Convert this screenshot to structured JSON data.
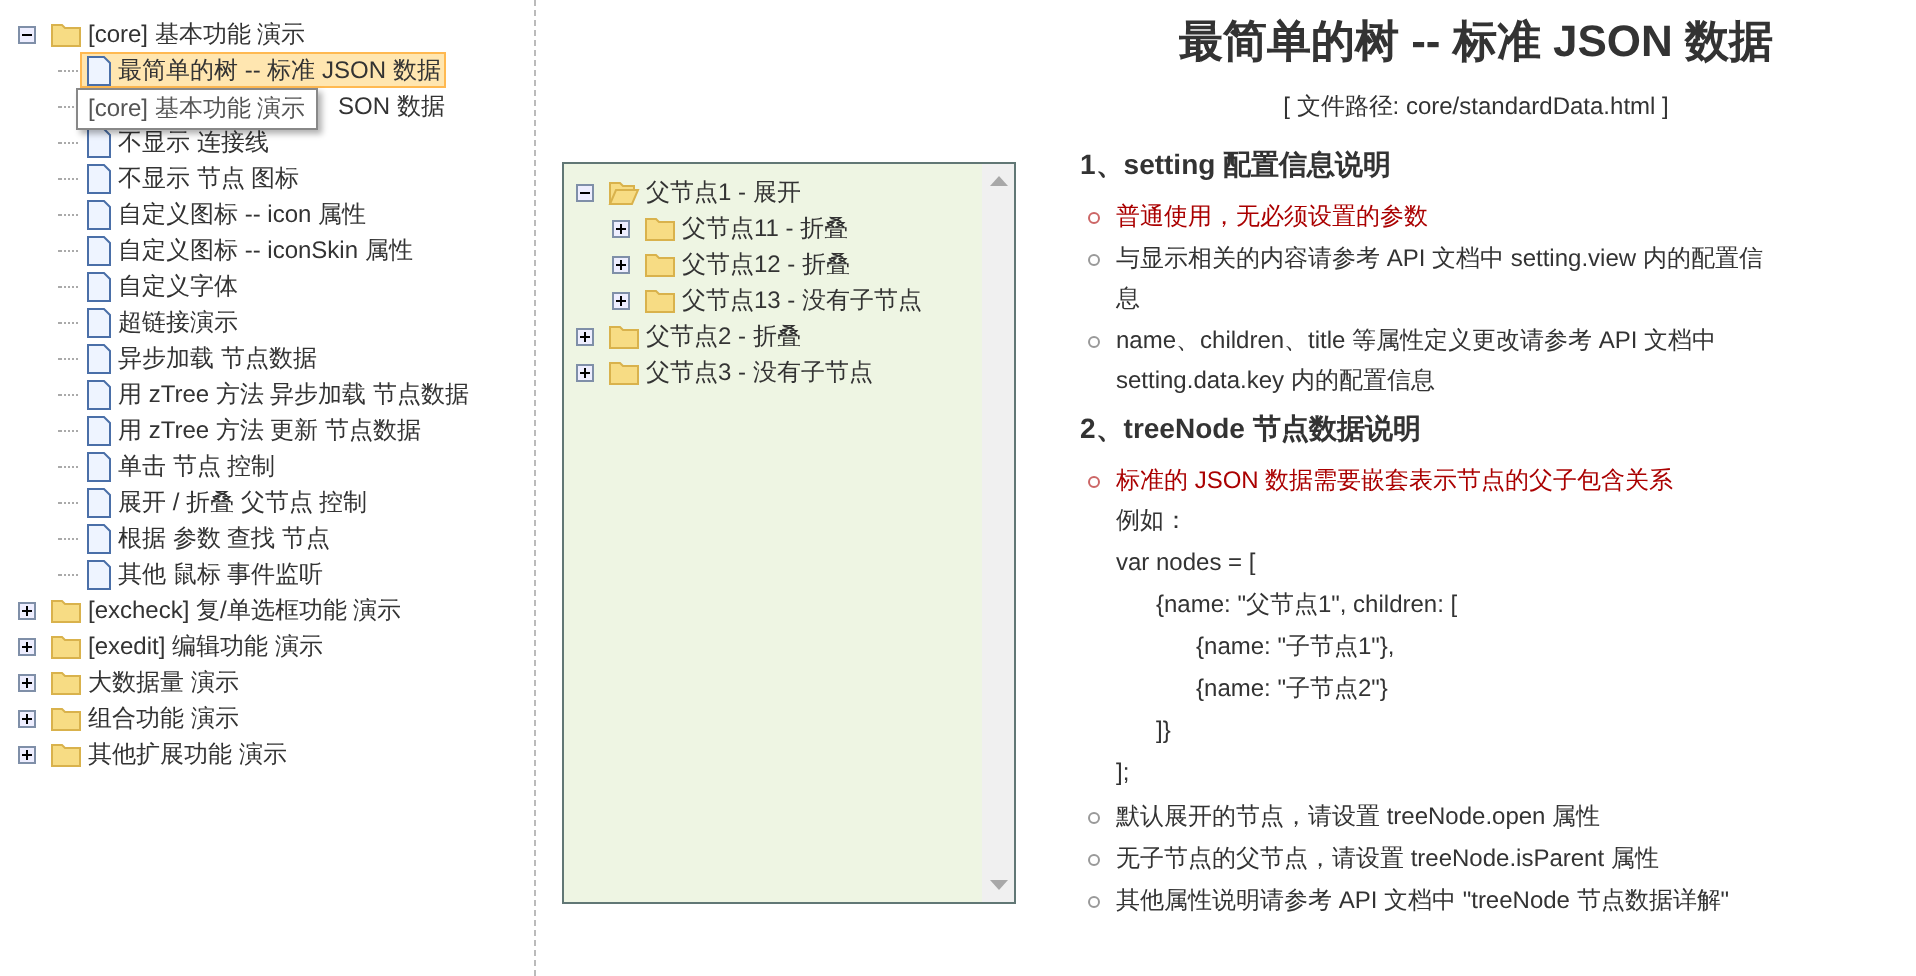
{
  "nav": {
    "items": [
      {
        "label": "[core] 基本功能 演示",
        "kind": "folder",
        "expanded": true,
        "selected": false,
        "children": [
          {
            "label": "最简单的树 -- 标准 JSON 数据",
            "kind": "page",
            "selected": true
          },
          {
            "label": "SON 数据",
            "kind": "page",
            "selected": false,
            "covered": true
          },
          {
            "label": "不显示 连接线",
            "kind": "page",
            "selected": false
          },
          {
            "label": "不显示 节点 图标",
            "kind": "page",
            "selected": false
          },
          {
            "label": "自定义图标 -- icon 属性",
            "kind": "page",
            "selected": false
          },
          {
            "label": "自定义图标 -- iconSkin 属性",
            "kind": "page",
            "selected": false
          },
          {
            "label": "自定义字体",
            "kind": "page",
            "selected": false
          },
          {
            "label": "超链接演示",
            "kind": "page",
            "selected": false
          },
          {
            "label": "异步加载 节点数据",
            "kind": "page",
            "selected": false
          },
          {
            "label": "用 zTree 方法 异步加载 节点数据",
            "kind": "page",
            "selected": false
          },
          {
            "label": "用 zTree 方法 更新 节点数据",
            "kind": "page",
            "selected": false
          },
          {
            "label": "单击 节点 控制",
            "kind": "page",
            "selected": false
          },
          {
            "label": "展开 / 折叠 父节点 控制",
            "kind": "page",
            "selected": false
          },
          {
            "label": "根据 参数 查找 节点",
            "kind": "page",
            "selected": false
          },
          {
            "label": "其他 鼠标 事件监听",
            "kind": "page",
            "selected": false
          }
        ]
      },
      {
        "label": "[excheck] 复/单选框功能 演示",
        "kind": "folder",
        "expanded": false,
        "selected": false
      },
      {
        "label": "[exedit] 编辑功能 演示",
        "kind": "folder",
        "expanded": false,
        "selected": false
      },
      {
        "label": "大数据量 演示",
        "kind": "folder",
        "expanded": false,
        "selected": false
      },
      {
        "label": "组合功能 演示",
        "kind": "folder",
        "expanded": false,
        "selected": false
      },
      {
        "label": "其他扩展功能 演示",
        "kind": "folder",
        "expanded": false,
        "selected": false
      }
    ],
    "tooltip": "[core] 基本功能 演示"
  },
  "demo_tree": {
    "items": [
      {
        "label": "父节点1 - 展开",
        "expanded": true,
        "children": [
          {
            "label": "父节点11 - 折叠",
            "expanded": false
          },
          {
            "label": "父节点12 - 折叠",
            "expanded": false
          },
          {
            "label": "父节点13 - 没有子节点",
            "expanded": false
          }
        ]
      },
      {
        "label": "父节点2 - 折叠",
        "expanded": false
      },
      {
        "label": "父节点3 - 没有子节点",
        "expanded": false
      }
    ]
  },
  "page": {
    "title": "最简单的树 -- 标准 JSON 数据",
    "path": "[ 文件路径: core/standardData.html ]",
    "sections": [
      {
        "heading": "1、setting 配置信息说明",
        "items": [
          {
            "text": "普通使用，无必须设置的参数",
            "kind": "note"
          },
          {
            "text": "与显示相关的内容请参考 API 文档中 setting.view 内的配置信息",
            "kind": "plain"
          },
          {
            "text": "name、children、title 等属性定义更改请参考 API 文档中 setting.data.key 内的配置信息",
            "kind": "plain"
          }
        ]
      },
      {
        "heading": "2、treeNode 节点数据说明",
        "items": [
          {
            "text": "标准的 JSON 数据需要嵌套表示节点的父子包含关系",
            "kind": "note",
            "example": [
              "例如：",
              "var nodes = [",
              "      {name: \"父节点1\", children: [",
              "            {name: \"子节点1\"},",
              "            {name: \"子节点2\"}",
              "      ]}",
              "];"
            ]
          },
          {
            "text": "默认展开的节点，请设置 treeNode.open 属性",
            "kind": "plain"
          },
          {
            "text": "无子节点的父节点，请设置 treeNode.isParent 属性",
            "kind": "plain"
          },
          {
            "text": "其他属性说明请参考 API 文档中 \"treeNode 节点数据详解\"",
            "kind": "plain"
          }
        ]
      }
    ]
  }
}
